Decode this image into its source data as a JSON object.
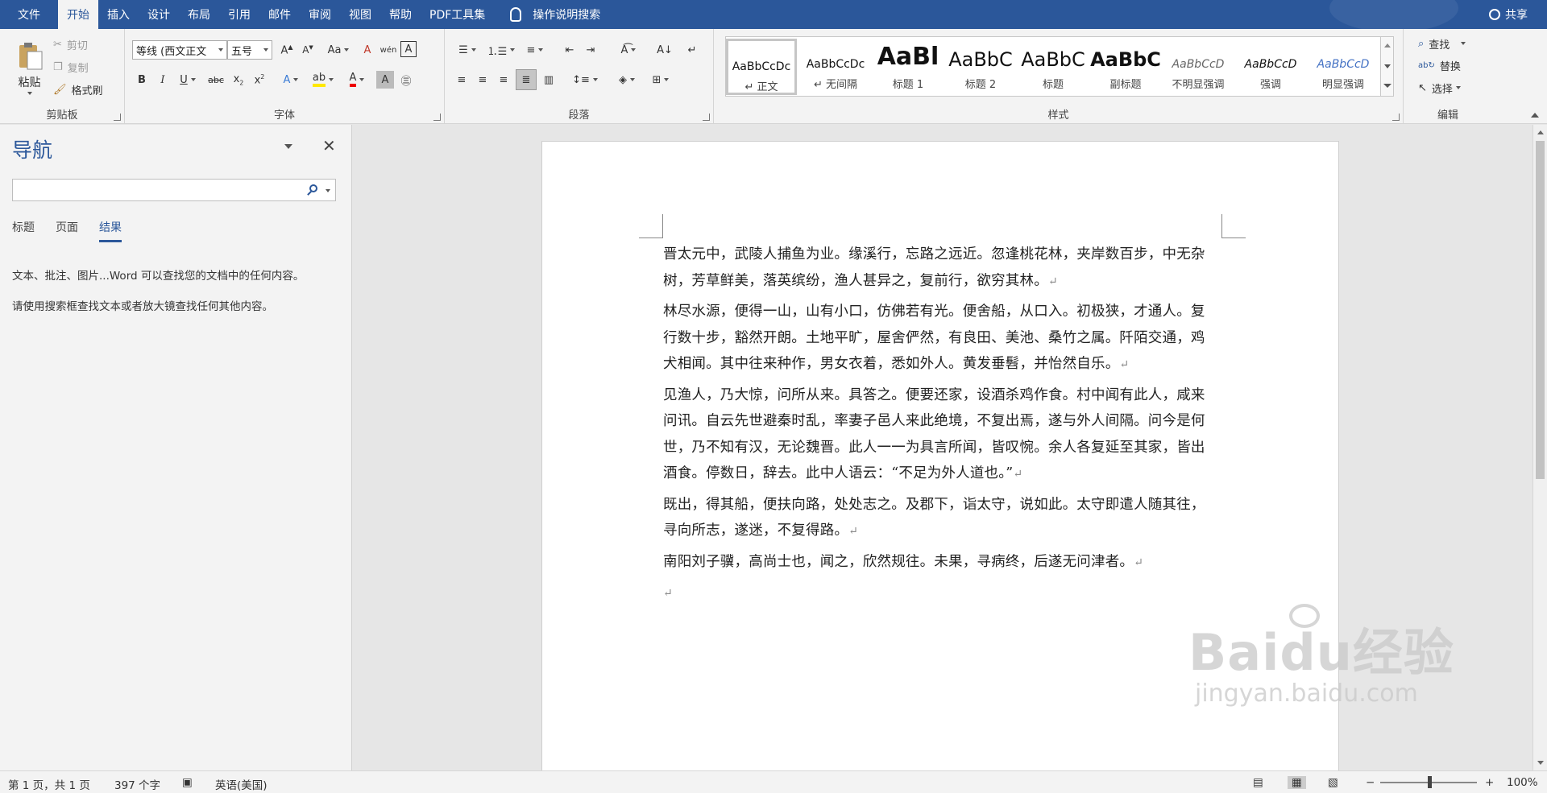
{
  "menubar": {
    "tabs": [
      "文件",
      "开始",
      "插入",
      "设计",
      "布局",
      "引用",
      "邮件",
      "审阅",
      "视图",
      "帮助",
      "PDF工具集"
    ],
    "active_tab": "开始",
    "tell_me": "操作说明搜索",
    "share": "共享"
  },
  "ribbon": {
    "clipboard": {
      "paste": "粘贴",
      "cut": "剪切",
      "copy": "复制",
      "format_painter": "格式刷",
      "label": "剪贴板"
    },
    "font": {
      "font_name": "等线 (西文正文",
      "font_size": "五号",
      "label": "字体"
    },
    "paragraph": {
      "label": "段落"
    },
    "styles": {
      "label": "样式",
      "items": [
        {
          "sample": "AaBbCcDc",
          "name": "↵ 正文"
        },
        {
          "sample": "AaBbCcDc",
          "name": "↵ 无间隔"
        },
        {
          "sample": "AaBl",
          "name": "标题 1"
        },
        {
          "sample": "AaBbC",
          "name": "标题 2"
        },
        {
          "sample": "AaBbC",
          "name": "标题"
        },
        {
          "sample": "AaBbC",
          "name": "副标题"
        },
        {
          "sample": "AaBbCcD",
          "name": "不明显强调"
        },
        {
          "sample": "AaBbCcD",
          "name": "强调"
        },
        {
          "sample": "AaBbCcD",
          "name": "明显强调"
        }
      ]
    },
    "editing": {
      "find": "查找",
      "replace": "替换",
      "select": "选择",
      "label": "编辑"
    }
  },
  "nav": {
    "title": "导航",
    "search_placeholder": "",
    "tabs": [
      "标题",
      "页面",
      "结果"
    ],
    "active_tab": "结果",
    "msg1": "文本、批注、图片...Word 可以查找您的文档中的任何内容。",
    "msg2": "请使用搜索框查找文本或者放大镜查找任何其他内容。"
  },
  "document": {
    "paragraphs": [
      "晋太元中，武陵人捕鱼为业。缘溪行，忘路之远近。忽逢桃花林，夹岸数百步，中无杂树，芳草鲜美，落英缤纷，渔人甚异之，复前行，欲穷其林。",
      "林尽水源，便得一山，山有小口，仿佛若有光。便舍船，从口入。初极狭，才通人。复行数十步，豁然开朗。土地平旷，屋舍俨然，有良田、美池、桑竹之属。阡陌交通，鸡犬相闻。其中往来种作，男女衣着，悉如外人。黄发垂髫，并怡然自乐。",
      "见渔人，乃大惊，问所从来。具答之。便要还家，设酒杀鸡作食。村中闻有此人，咸来问讯。自云先世避秦时乱，率妻子邑人来此绝境，不复出焉，遂与外人间隔。问今是何世，乃不知有汉，无论魏晋。此人一一为具言所闻，皆叹惋。余人各复延至其家，皆出酒食。停数日，辞去。此中人语云：“不足为外人道也。”",
      "既出，得其船，便扶向路，处处志之。及郡下，诣太守，说如此。太守即遣人随其往，寻向所志，遂迷，不复得路。",
      "南阳刘子骥，高尚士也，闻之，欣然规往。未果，寻病终，后遂无问津者。"
    ]
  },
  "status": {
    "page": "第 1 页，共 1 页",
    "words": "397 个字",
    "language": "英语(美国)",
    "zoom": "100%"
  },
  "watermark": {
    "line1": "Baidu经验",
    "line2": "jingyan.baidu.com"
  },
  "colors": {
    "brand": "#2b579a",
    "ribbon_bg": "#f3f3f3",
    "doc_bg": "#e6e6e6"
  }
}
